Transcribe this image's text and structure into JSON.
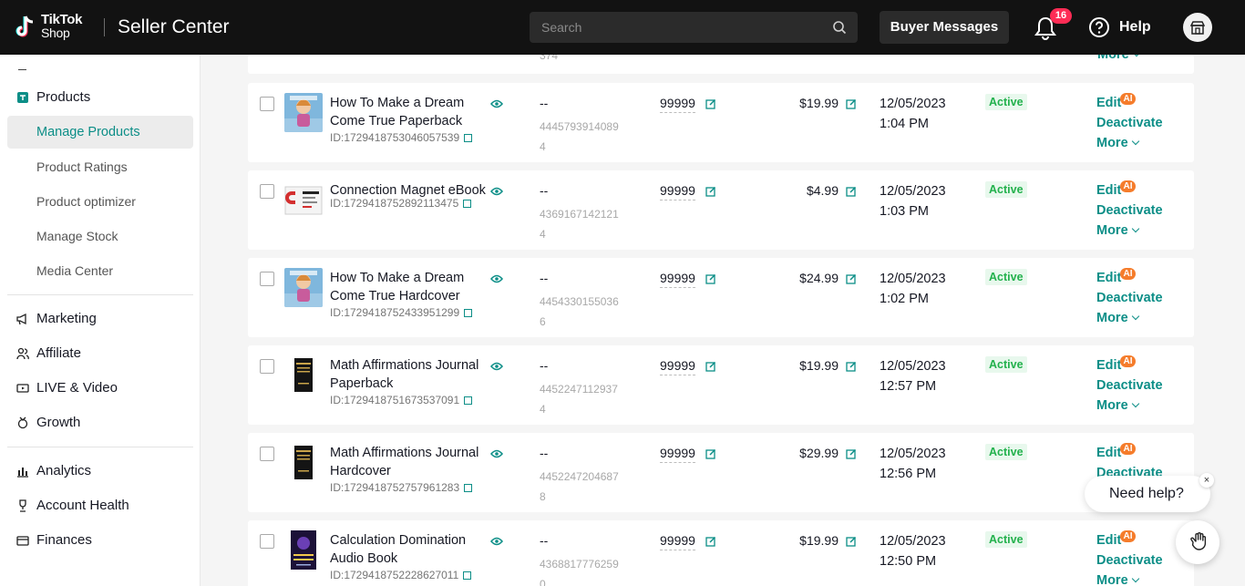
{
  "header": {
    "logo_top": "TikTok",
    "logo_bottom": "Shop",
    "title": "Seller Center",
    "search_placeholder": "Search",
    "buyer_messages": "Buyer Messages",
    "notification_count": "16",
    "help": "Help"
  },
  "sidebar": {
    "products": "Products",
    "sub": [
      "Manage Products",
      "Product Ratings",
      "Product optimizer",
      "Manage Stock",
      "Media Center"
    ],
    "groups": [
      "Marketing",
      "Affiliate",
      "LIVE & Video",
      "Growth"
    ],
    "groups2": [
      "Analytics",
      "Account Health",
      "Finances"
    ]
  },
  "partial_row": {
    "sku_tail": "374",
    "more": "More"
  },
  "rows": [
    {
      "name": "How To Make a Dream Come True Paperback",
      "id": "ID:1729418753046057539",
      "dash": "--",
      "sku": "44457939140894",
      "stock": "99999",
      "price": "$19.99",
      "date": "12/05/2023",
      "time": "1:04 PM",
      "status": "Active",
      "edit": "Edit",
      "ai": "AI",
      "deactivate": "Deactivate",
      "more": "More",
      "thumb": "dream"
    },
    {
      "name": "Connection Magnet eBook",
      "id": "ID:1729418752892113475",
      "dash": "--",
      "sku": "43691671421214",
      "stock": "99999",
      "price": "$4.99",
      "date": "12/05/2023",
      "time": "1:03 PM",
      "status": "Active",
      "edit": "Edit",
      "ai": "AI",
      "deactivate": "Deactivate",
      "more": "More",
      "thumb": "magnet"
    },
    {
      "name": "How To Make a Dream Come True Hardcover",
      "id": "ID:1729418752433951299",
      "dash": "--",
      "sku": "44543301550366",
      "stock": "99999",
      "price": "$24.99",
      "date": "12/05/2023",
      "time": "1:02 PM",
      "status": "Active",
      "edit": "Edit",
      "ai": "AI",
      "deactivate": "Deactivate",
      "more": "More",
      "thumb": "dream"
    },
    {
      "name": "Math Affirmations Journal Paperback",
      "id": "ID:1729418751673537091",
      "dash": "--",
      "sku": "44522471129374",
      "stock": "99999",
      "price": "$19.99",
      "date": "12/05/2023",
      "time": "12:57 PM",
      "status": "Active",
      "edit": "Edit",
      "ai": "AI",
      "deactivate": "Deactivate",
      "more": "More",
      "thumb": "math"
    },
    {
      "name": "Math Affirmations Journal Hardcover",
      "id": "ID:1729418752757961283",
      "dash": "--",
      "sku": "44522472046878",
      "stock": "99999",
      "price": "$29.99",
      "date": "12/05/2023",
      "time": "12:56 PM",
      "status": "Active",
      "edit": "Edit",
      "ai": "AI",
      "deactivate": "Deactivate",
      "more": "More",
      "thumb": "math"
    },
    {
      "name": "Calculation Domination Audio Book",
      "id": "ID:1729418752228627011",
      "dash": "--",
      "sku": "43688177762590",
      "stock": "99999",
      "price": "$19.99",
      "date": "12/05/2023",
      "time": "12:50 PM",
      "status": "Active",
      "edit": "Edit",
      "ai": "AI",
      "deactivate": "Deactivate",
      "more": "More",
      "thumb": "calc"
    }
  ],
  "help_widget": {
    "text": "Need help?",
    "close": "×"
  },
  "colors": {
    "accent": "#0c8e87",
    "status_green": "#22b14c",
    "ai_orange": "#f57c2b",
    "badge_red": "#fe2c55"
  }
}
